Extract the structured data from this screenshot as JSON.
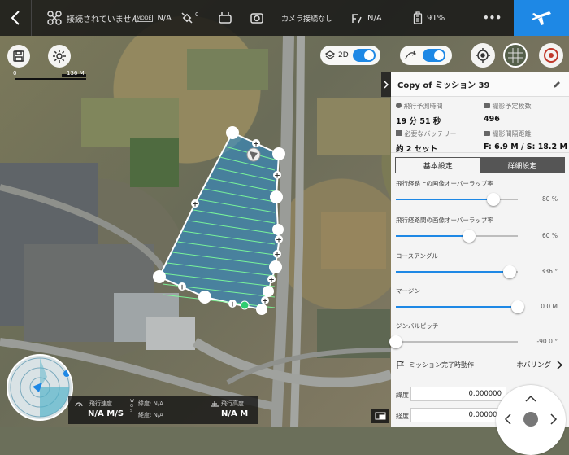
{
  "topbar": {
    "drone_status": "接続されていません",
    "sig_badge": "MODE",
    "sig_value": "N/A",
    "satellites": "0",
    "camera_status": "カメラ接続なし",
    "rc_value": "N/A",
    "battery": "91%",
    "more": "•••"
  },
  "map": {
    "mode_label": "2D",
    "scale_start": "0",
    "scale_end": "136 M"
  },
  "panel": {
    "title": "Copy of ミッション 39",
    "flight_time_label": "飛行予測時間",
    "flight_time_value": "19 分 51 秒",
    "photos_label": "撮影予定枚数",
    "photos_value": "496",
    "battery_label": "必要なバッテリー",
    "battery_value": "約 2 セット",
    "interval_label": "撮影間隔距離",
    "interval_value": "F: 6.9 M / S: 18.2 M",
    "tab_basic": "基本設定",
    "tab_detail": "詳細設定",
    "sliders": [
      {
        "label": "飛行経路上の画像オーバーラップ率",
        "value": "80 %",
        "level": 0.8
      },
      {
        "label": "飛行経路間の画像オーバーラップ率",
        "value": "60 %",
        "level": 0.6
      },
      {
        "label": "コースアングル",
        "value": "336 °",
        "level": 0.93
      },
      {
        "label": "マージン",
        "value": "0.0 M",
        "level": 1.0
      },
      {
        "label": "ジンバルピッチ",
        "value": "-90.0 °",
        "level": 0.0
      }
    ],
    "mission_end_label": "ミッション完了時動作",
    "mission_end_value": "ホバリング",
    "lat_label": "緯度",
    "lat_value": "0.000000",
    "lon_label": "経度",
    "lon_value": "0.000000"
  },
  "telemetry": {
    "speed_label": "飛行速度",
    "speed_value": "N/A M/S",
    "lat_label": "緯度: N/A",
    "lon_label": "経度: N/A",
    "alt_label": "飛行高度",
    "alt_value": "N/A M",
    "gps_letters": "WGS"
  },
  "colors": {
    "accent": "#1e88e5",
    "polygon_fill": "#2a8fd6",
    "flight_lines": "#7dff9a"
  }
}
